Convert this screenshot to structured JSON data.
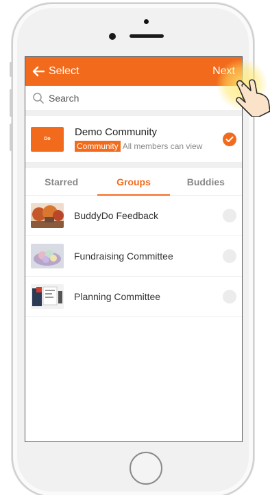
{
  "appbar": {
    "title": "Select",
    "next_label": "Next"
  },
  "search": {
    "placeholder": "Search"
  },
  "community": {
    "logo_text": "Do",
    "name": "Demo Community",
    "tag": "Community",
    "description": "All members can view",
    "selected": true
  },
  "tabs": [
    {
      "label": "Starred",
      "active": false
    },
    {
      "label": "Groups",
      "active": true
    },
    {
      "label": "Buddies",
      "active": false
    }
  ],
  "groups": [
    {
      "name": "BuddyDo Feedback",
      "thumb": "autumn-trees-photo",
      "selected": false
    },
    {
      "name": "Fundraising Committee",
      "thumb": "macarons-photo",
      "selected": false
    },
    {
      "name": "Planning Committee",
      "thumb": "desk-planner-photo",
      "selected": false
    }
  ],
  "colors": {
    "accent": "#f26b1d",
    "text": "#222222",
    "muted": "#888888"
  },
  "icons": {
    "back": "arrow-left-icon",
    "search": "search-icon",
    "check": "check-icon",
    "hand": "tap-hand-icon"
  }
}
